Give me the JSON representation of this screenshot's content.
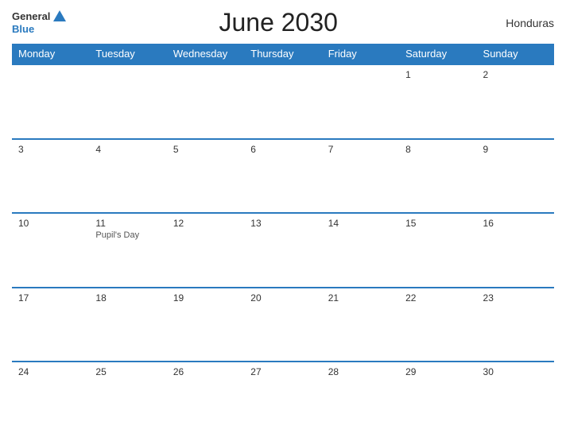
{
  "header": {
    "logo_general": "General",
    "logo_blue": "Blue",
    "title": "June 2030",
    "country": "Honduras"
  },
  "weekdays": [
    "Monday",
    "Tuesday",
    "Wednesday",
    "Thursday",
    "Friday",
    "Saturday",
    "Sunday"
  ],
  "weeks": [
    [
      {
        "day": "",
        "holiday": "",
        "empty": true
      },
      {
        "day": "",
        "holiday": "",
        "empty": true
      },
      {
        "day": "",
        "holiday": "",
        "empty": true
      },
      {
        "day": "",
        "holiday": "",
        "empty": true
      },
      {
        "day": "",
        "holiday": "",
        "empty": true
      },
      {
        "day": "1",
        "holiday": ""
      },
      {
        "day": "2",
        "holiday": ""
      }
    ],
    [
      {
        "day": "3",
        "holiday": ""
      },
      {
        "day": "4",
        "holiday": ""
      },
      {
        "day": "5",
        "holiday": ""
      },
      {
        "day": "6",
        "holiday": ""
      },
      {
        "day": "7",
        "holiday": ""
      },
      {
        "day": "8",
        "holiday": ""
      },
      {
        "day": "9",
        "holiday": ""
      }
    ],
    [
      {
        "day": "10",
        "holiday": ""
      },
      {
        "day": "11",
        "holiday": "Pupil's Day"
      },
      {
        "day": "12",
        "holiday": ""
      },
      {
        "day": "13",
        "holiday": ""
      },
      {
        "day": "14",
        "holiday": ""
      },
      {
        "day": "15",
        "holiday": ""
      },
      {
        "day": "16",
        "holiday": ""
      }
    ],
    [
      {
        "day": "17",
        "holiday": ""
      },
      {
        "day": "18",
        "holiday": ""
      },
      {
        "day": "19",
        "holiday": ""
      },
      {
        "day": "20",
        "holiday": ""
      },
      {
        "day": "21",
        "holiday": ""
      },
      {
        "day": "22",
        "holiday": ""
      },
      {
        "day": "23",
        "holiday": ""
      }
    ],
    [
      {
        "day": "24",
        "holiday": ""
      },
      {
        "day": "25",
        "holiday": ""
      },
      {
        "day": "26",
        "holiday": ""
      },
      {
        "day": "27",
        "holiday": ""
      },
      {
        "day": "28",
        "holiday": ""
      },
      {
        "day": "29",
        "holiday": ""
      },
      {
        "day": "30",
        "holiday": ""
      }
    ]
  ]
}
